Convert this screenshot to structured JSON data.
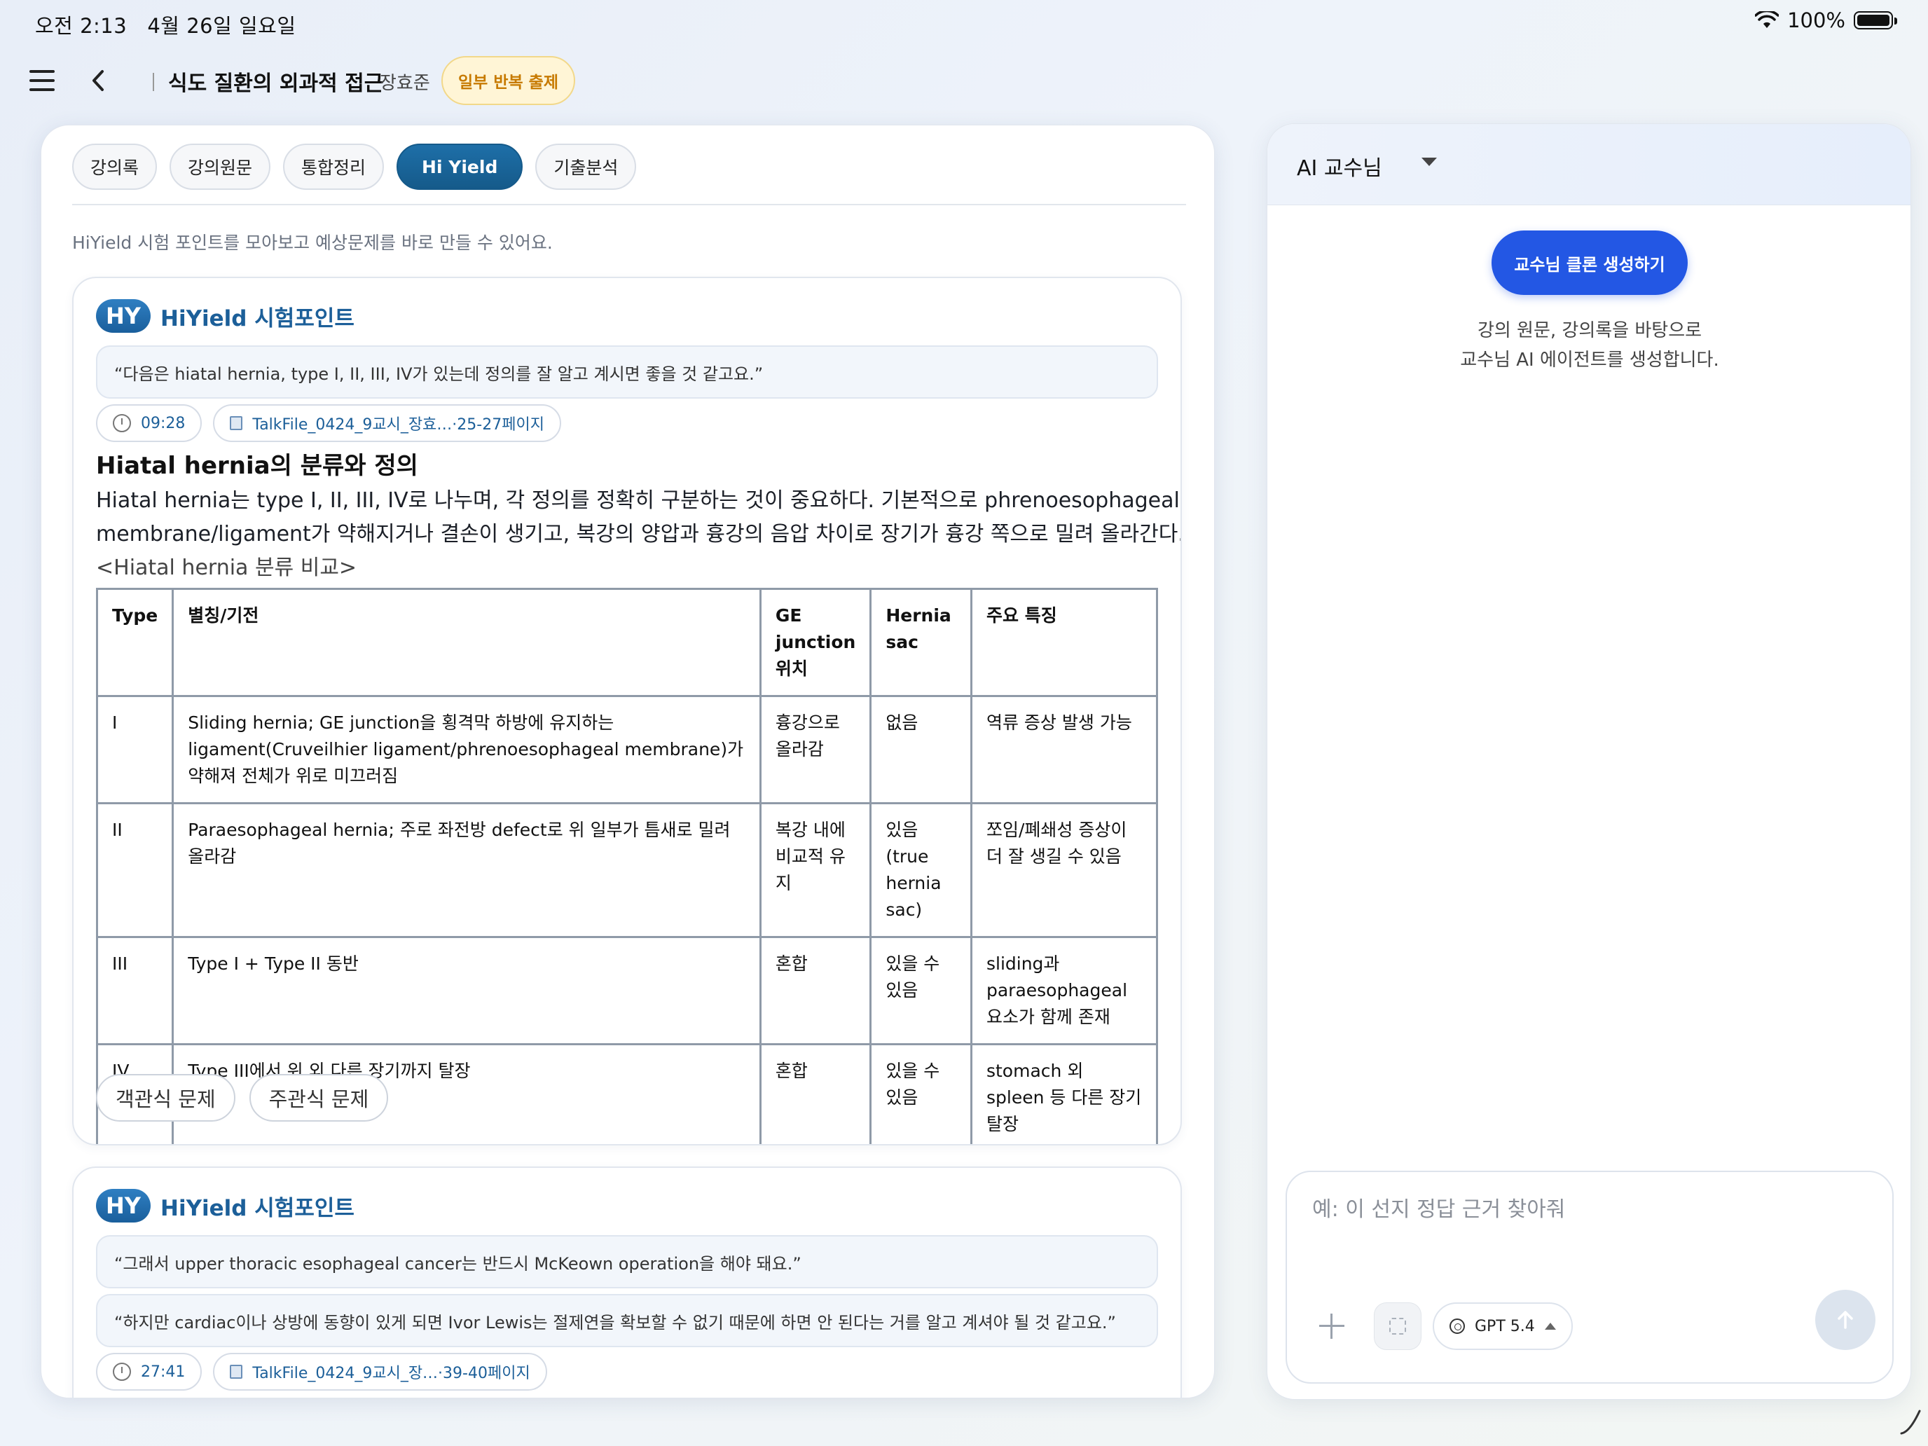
{
  "status_bar": {
    "time_date": "오전 2:13   4월 26일 일요일",
    "battery": "100%"
  },
  "header": {
    "course_title": "식도 질환의 외과적 접근",
    "professor": "장효준",
    "badge": "일부 반복 출제"
  },
  "tabs": [
    "강의록",
    "강의원문",
    "통합정리",
    "Hi Yield",
    "기출분석"
  ],
  "active_tab": "Hi Yield",
  "intro": "HiYield 시험 포인트를 모아보고 예상문제를 바로 만들 수 있어요.",
  "cards": [
    {
      "logo": "HY",
      "title": "HiYield 시험포인트",
      "quotes": [
        "“다음은 hiatal hernia, type I, II, III, IV가 있는데 정의를 잘 알고 계시면 좋을 것 같고요.”"
      ],
      "time": "09:28",
      "file": "TalkFile_0424_9교시_장효…·25-27페이지",
      "heading": "Hiatal hernia의 분류와 정의",
      "body_line1": "Hiatal hernia는 type I, II, III, IV로 나누며, 각 정의를 정확히 구분하는 것이 중요하다. 기본적으로 phrenoesophageal",
      "body_line2": "membrane/ligament가 약해지거나 결손이 생기고, 복강의 양압과 흉강의 음압 차이로 장기가 흉강 쪽으로 밀려 올라간다.",
      "caption": "<Hiatal hernia 분류 비교>",
      "table": {
        "headers": [
          "Type",
          "별칭/기전",
          "GE junction 위치",
          "Hernia sac",
          "주요 특징"
        ],
        "rows": [
          [
            "I",
            "Sliding hernia; GE junction을 횡격막 하방에 유지하는 ligament(Cruveilhier ligament/phrenoesophageal membrane)가 약해져 전체가 위로 미끄러짐",
            "흉강으로 올라감",
            "없음",
            "역류 증상 발생 가능"
          ],
          [
            "II",
            "Paraesophageal hernia; 주로 좌전방 defect로 위 일부가 틈새로 밀려 올라감",
            "복강 내에 비교적 유지",
            "있음(true hernia sac)",
            "쪼임/폐쇄성 증상이 더 잘 생길 수 있음"
          ],
          [
            "III",
            "Type I + Type II 동반",
            "혼합",
            "있을 수 있음",
            "sliding과 paraesophageal 요소가 함께 존재"
          ],
          [
            "IV",
            "Type III에서 위 외 다른 장기까지 탈장",
            "혼합",
            "있을 수 있음",
            "stomach 외 spleen 등 다른 장기 탈장"
          ]
        ]
      },
      "buttons": [
        "객관식 문제",
        "주관식 문제"
      ]
    },
    {
      "logo": "HY",
      "title": "HiYield 시험포인트",
      "quotes": [
        "“그래서 upper thoracic esophageal cancer는 반드시 McKeown operation을 해야 돼요.”",
        "“하지만 cardiac이나 상방에 동향이 있게 되면 Ivor Lewis는 절제연을 확보할 수 없기 때문에 하면 안 된다는 거를 알고 계셔야 될 것 같고요.”"
      ],
      "time": "27:41",
      "file": "TalkFile_0424_9교시_장…·39-40페이지"
    }
  ],
  "ai_panel": {
    "title": "AI 교수님",
    "clone_button": "교수님 클론 생성하기",
    "desc_line1": "강의 원문, 강의록을 바탕으로",
    "desc_line2": "교수님 AI 에이전트를 생성합니다.",
    "input_placeholder": "예: 이 선지 정답 근거 찾아줘",
    "model": "GPT 5.4"
  },
  "colors": {
    "accent_tab": "#1e6fa8",
    "clone_button": "#2357e4",
    "hy_title": "#1c5f99",
    "badge_text": "#c77a00"
  }
}
